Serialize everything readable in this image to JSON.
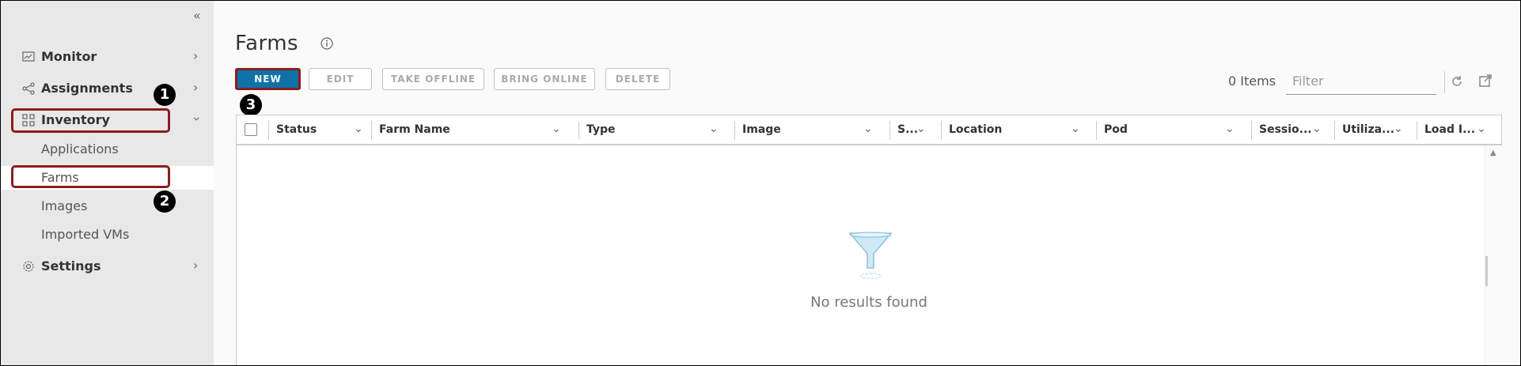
{
  "sidebar": {
    "collapse_icon": "double-chevron-left",
    "items": [
      {
        "label": "Monitor",
        "icon": "monitor-icon"
      },
      {
        "label": "Assignments",
        "icon": "share-icon"
      },
      {
        "label": "Inventory",
        "icon": "grid-icon"
      },
      {
        "label": "Settings",
        "icon": "gear-icon"
      }
    ],
    "subitems": [
      {
        "label": "Applications"
      },
      {
        "label": "Farms"
      },
      {
        "label": "Images"
      },
      {
        "label": "Imported VMs"
      }
    ]
  },
  "callouts": [
    "1",
    "2",
    "3"
  ],
  "page": {
    "title": "Farms"
  },
  "toolbar": {
    "new": "NEW",
    "edit": "EDIT",
    "take_offline": "TAKE OFFLINE",
    "bring_online": "BRING ONLINE",
    "delete": "DELETE"
  },
  "grid": {
    "items_count": "0 Items",
    "filter_placeholder": "Filter",
    "columns": [
      "Status",
      "Farm Name",
      "Type",
      "Image",
      "S...",
      "Location",
      "Pod",
      "Sessio...",
      "Utiliza...",
      "Load I..."
    ],
    "empty_text": "No results found"
  },
  "colors": {
    "accent": "#0e72a8",
    "highlight": "#8b1d1d"
  }
}
